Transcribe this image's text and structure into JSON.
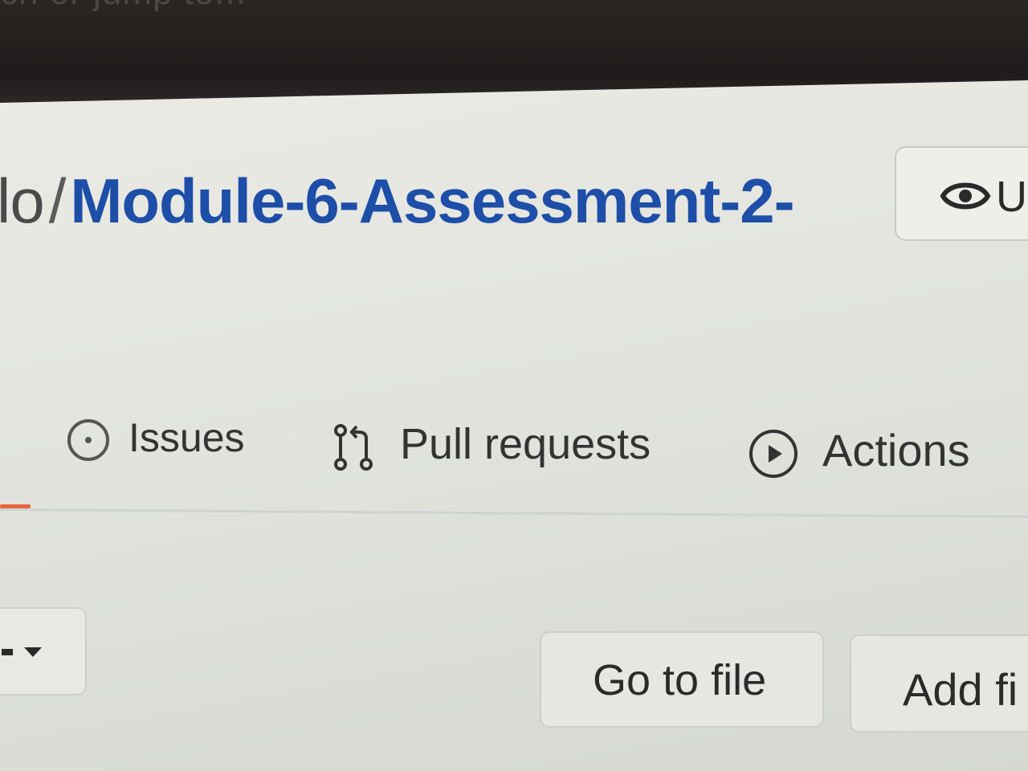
{
  "top_bar": {
    "search_hint": "ch or jump to..."
  },
  "repo": {
    "owner": "lo",
    "separator": "/",
    "name": "Module-6-Assessment-2-"
  },
  "watch_button": {
    "label": "U",
    "icon": "eye-icon"
  },
  "tabs": [
    {
      "label": "Issues",
      "icon": "issue-opened-icon"
    },
    {
      "label": "Pull requests",
      "icon": "git-pull-request-icon"
    },
    {
      "label": "Actions",
      "icon": "play-icon"
    }
  ],
  "toolbar": {
    "goto_file_label": "Go to file",
    "add_file_label": "Add fi"
  },
  "colors": {
    "repo_link": "#1d4ea8",
    "active_tab_underline": "#e8643f"
  }
}
